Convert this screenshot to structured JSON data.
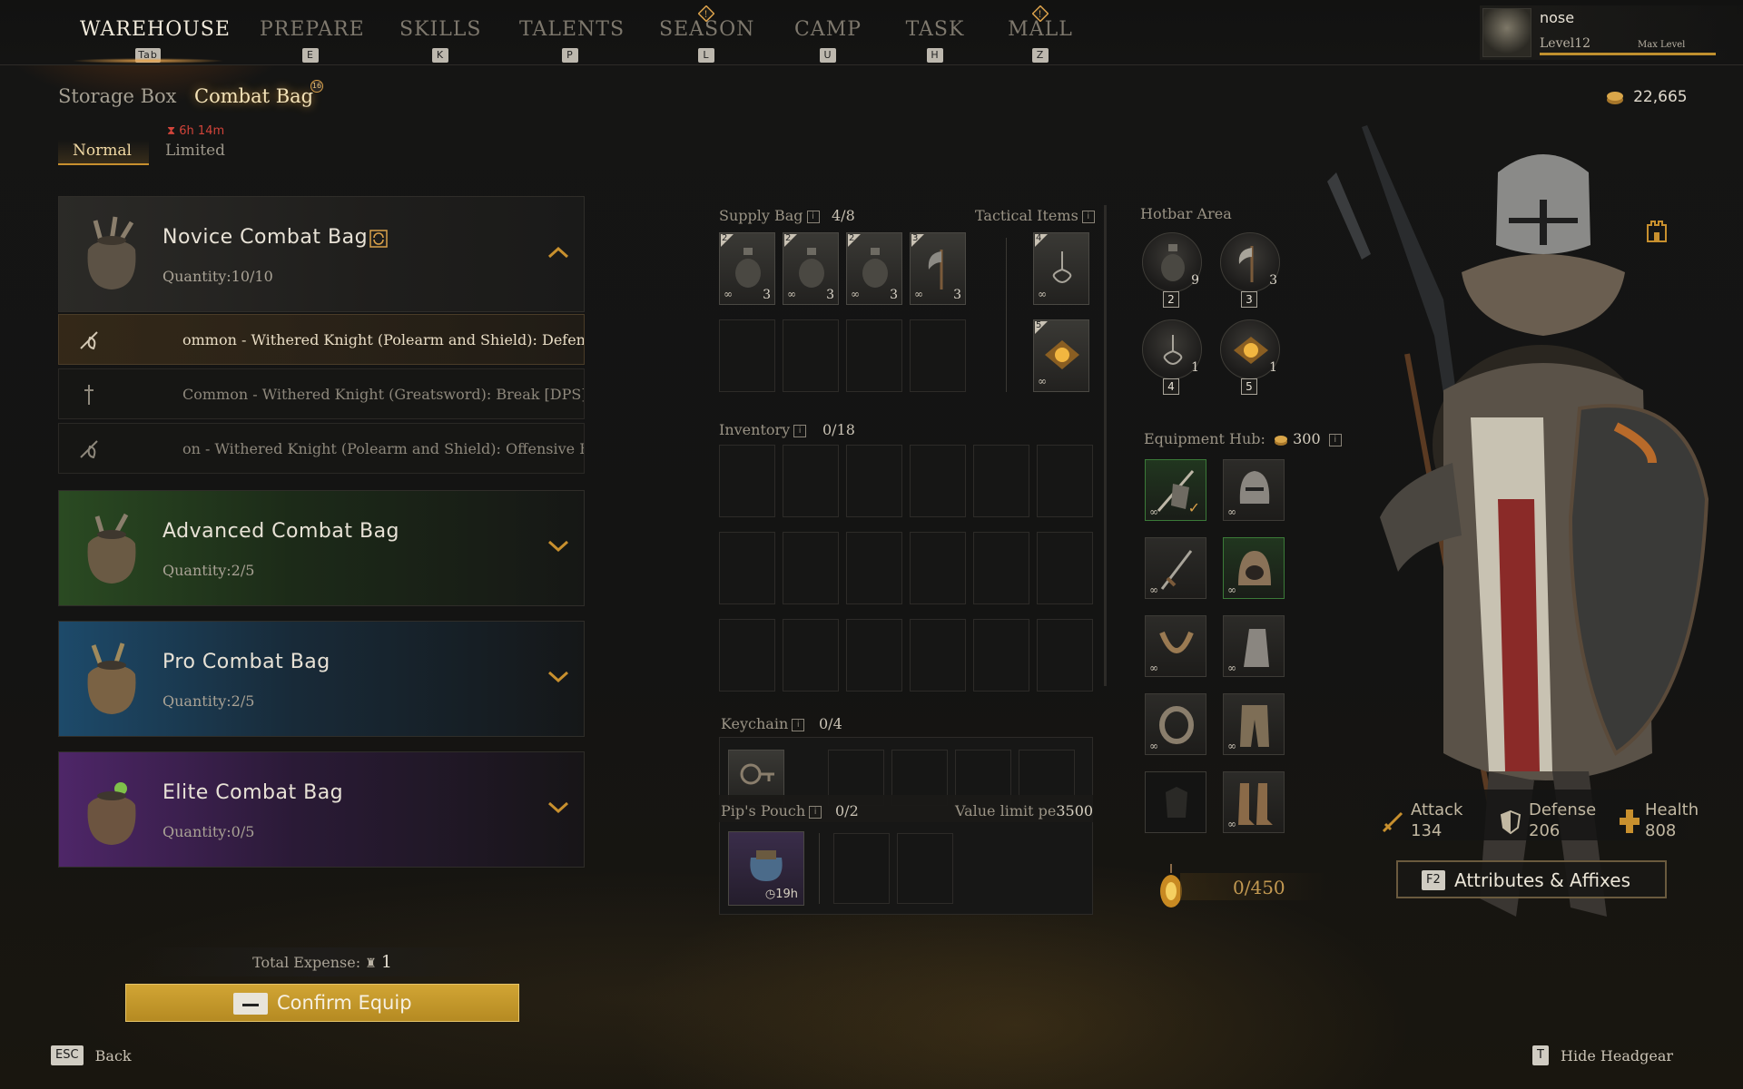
{
  "nav": {
    "items": [
      {
        "label": "WAREHOUSE",
        "key": "Tab"
      },
      {
        "label": "PREPARE",
        "key": "E"
      },
      {
        "label": "SKILLS",
        "key": "K"
      },
      {
        "label": "TALENTS",
        "key": "P"
      },
      {
        "label": "SEASON",
        "key": "L"
      },
      {
        "label": "CAMP",
        "key": "U"
      },
      {
        "label": "TASK",
        "key": "H"
      },
      {
        "label": "MALL",
        "key": "Z"
      }
    ]
  },
  "profile": {
    "name": "nose",
    "level": "Level12",
    "max_level": "Max Level"
  },
  "currency": {
    "gold": "22,665"
  },
  "subtabs": {
    "storage": "Storage Box",
    "combat": "Combat Bag",
    "combat_badge": "16"
  },
  "modes": {
    "normal": "Normal",
    "limited": "Limited",
    "timer": "6h 14m"
  },
  "bags": [
    {
      "title": "Novice Combat Bag",
      "quantity": "Quantity:10/10"
    },
    {
      "title": "Advanced Combat Bag",
      "quantity": "Quantity:2/5"
    },
    {
      "title": "Pro Combat Bag",
      "quantity": "Quantity:2/5"
    },
    {
      "title": "Elite Combat Bag",
      "quantity": "Quantity:0/5"
    }
  ],
  "builds": [
    "ommon - Withered Knight (Polearm and Shield): Defensive Build |",
    "Common - Withered Knight (Greatsword): Break [DPS]",
    "on - Withered Knight (Polearm and Shield): Offensive Build [DPS]"
  ],
  "footer_left": {
    "expense_label": "Total Expense:",
    "expense_value": "1",
    "confirm": "Confirm Equip",
    "esc_key": "ESC",
    "back": "Back"
  },
  "supply": {
    "label": "Supply Bag",
    "count": "4/8",
    "items": [
      {
        "tag": "2",
        "qty": "3"
      },
      {
        "tag": "2",
        "qty": "3"
      },
      {
        "tag": "2",
        "qty": "3"
      },
      {
        "tag": "3",
        "qty": "3"
      }
    ]
  },
  "tactical": {
    "label": "Tactical Items",
    "tags": [
      "4",
      "5"
    ]
  },
  "inventory": {
    "label": "Inventory",
    "count": "0/18"
  },
  "keychain": {
    "label": "Keychain",
    "count": "0/4"
  },
  "pouch": {
    "label": "Pip's Pouch",
    "count": "0/2",
    "limit_label": "Value limit pe",
    "limit_value": "3500",
    "timer": "19h"
  },
  "hotbar": {
    "label": "Hotbar Area",
    "slots": [
      {
        "qty": "9",
        "num": "2"
      },
      {
        "qty": "3",
        "num": "3"
      },
      {
        "qty": "1",
        "num": "4"
      },
      {
        "qty": "1",
        "num": "5"
      }
    ]
  },
  "equipment": {
    "label": "Equipment Hub:",
    "cost": "300"
  },
  "weight": {
    "value": "0/450"
  },
  "stats": [
    {
      "label": "Attack",
      "value": "134"
    },
    {
      "label": "Defense",
      "value": "206"
    },
    {
      "label": "Health",
      "value": "808"
    }
  ],
  "attributes": {
    "key": "F2",
    "label": "Attributes & Affixes"
  },
  "footer_right": {
    "key": "T",
    "label": "Hide Headgear"
  },
  "colors": {
    "accent": "#e6a24a",
    "confirm": "#c79a2a",
    "green": "#3b7a38",
    "timer_red": "#d2443a"
  }
}
